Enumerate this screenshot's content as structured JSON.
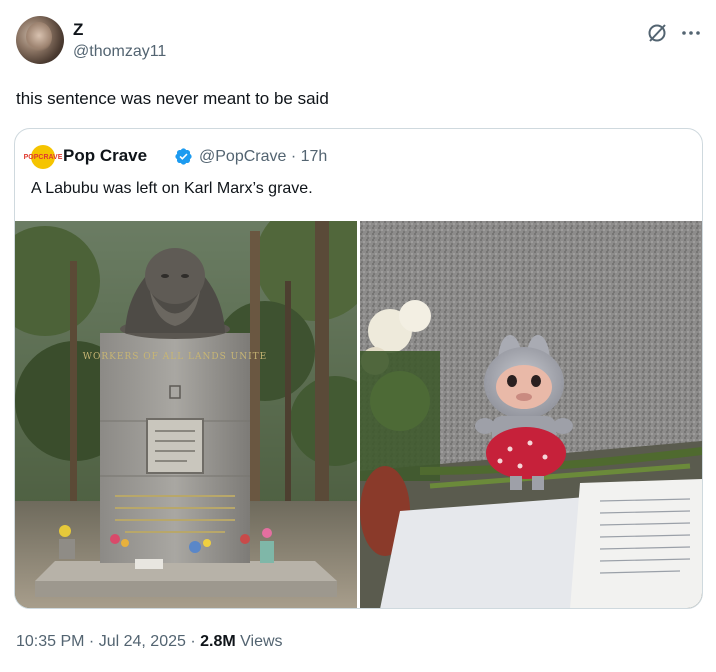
{
  "author": {
    "display_name": "Z",
    "handle": "@thomzay11"
  },
  "tweet": {
    "text": "this sentence was never meant to be said"
  },
  "quoted_tweet": {
    "logo_text": "POP CRAVE",
    "display_name": "Pop Crave",
    "handle_time": "@PopCrave · 17h",
    "text": "A Labubu was left on Karl Marx’s grave.",
    "photos": [
      {
        "alt": "Karl Marx grave monument with flowers",
        "engraving": "WORKERS OF ALL LANDS UNITE"
      },
      {
        "alt": "Labubu plush toy on grave with flowers and paper"
      }
    ]
  },
  "meta": {
    "time_date": "10:35 PM · Jul 24, 2025 · ",
    "views_count": "2.8M",
    "views_label": " Views"
  },
  "colors": {
    "verified": "#1d9bf0",
    "secondary_text": "#536471",
    "border": "#cfd9de"
  },
  "icons": [
    "grok-icon",
    "more-icon",
    "verified-badge-icon"
  ]
}
